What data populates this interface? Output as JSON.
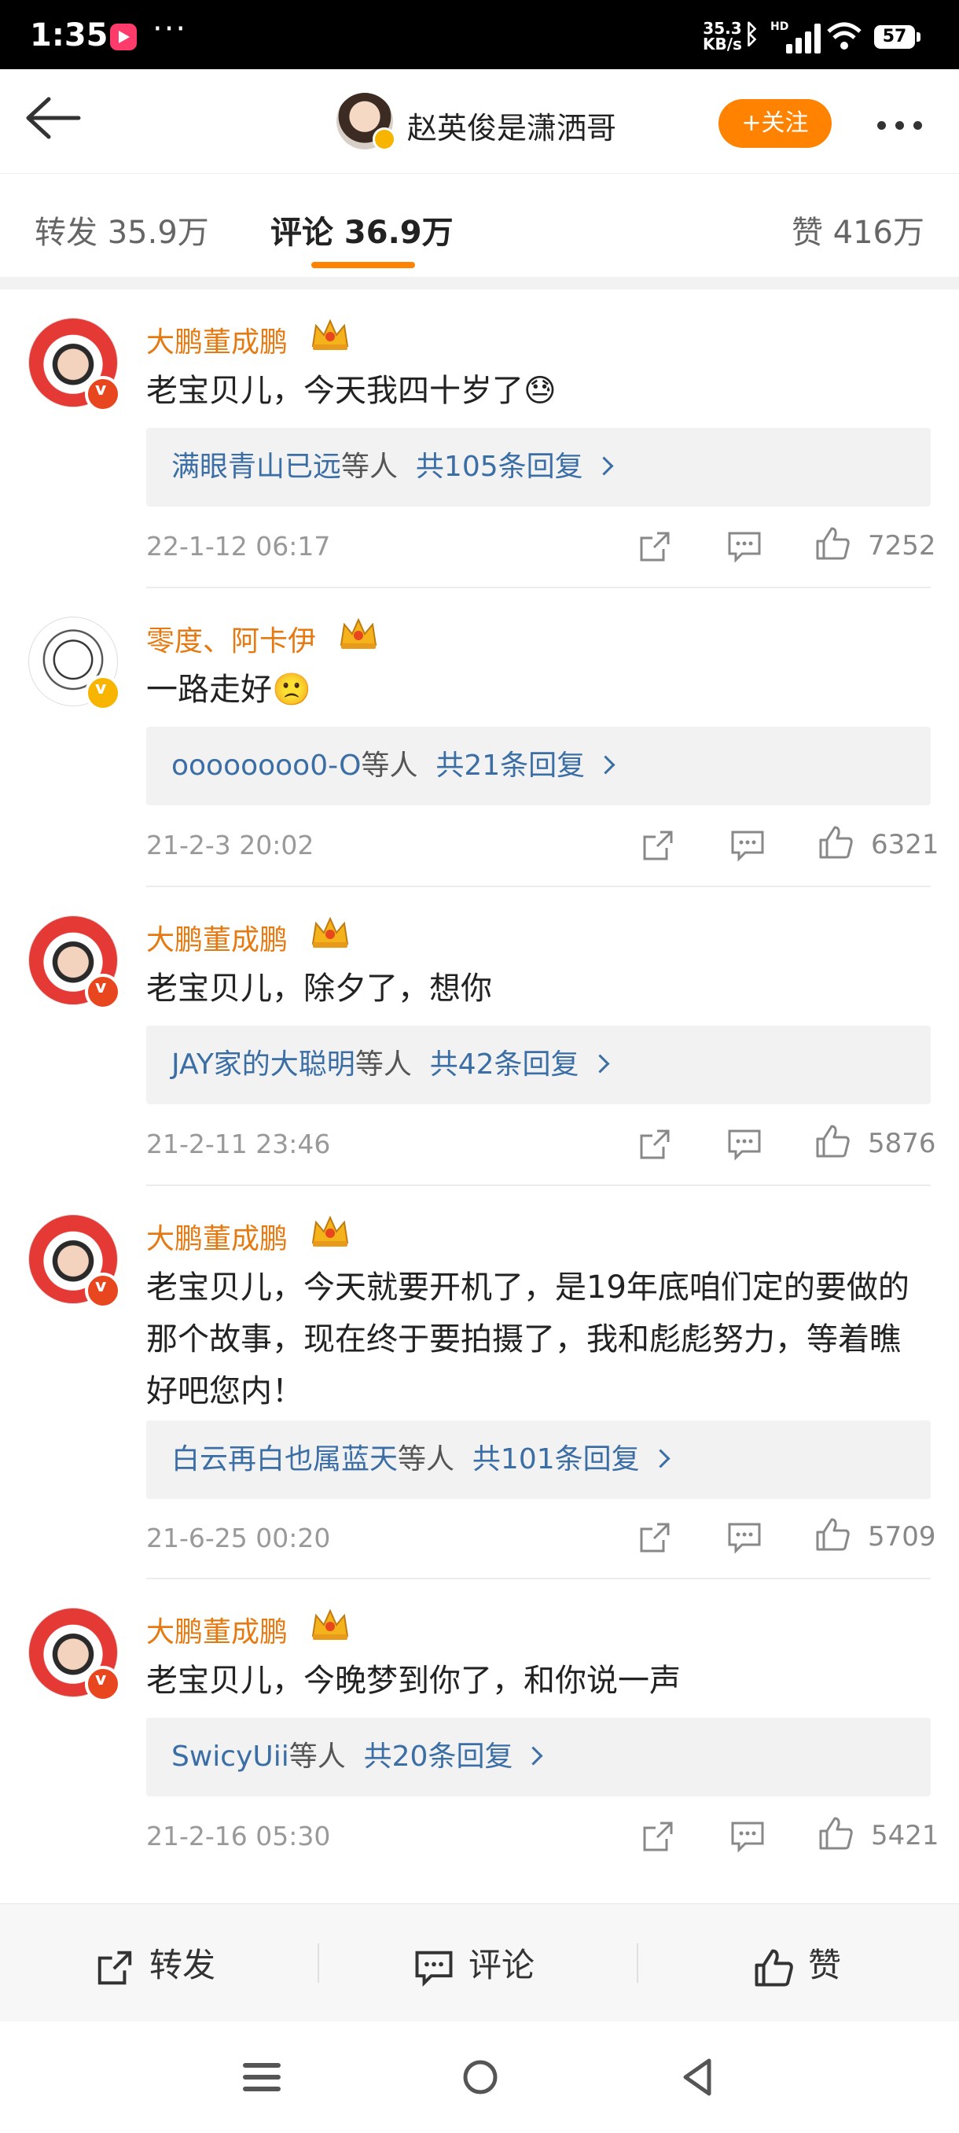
{
  "status_bar": {
    "time": "1:35",
    "speed_value": "35.3",
    "speed_unit": "KB/s",
    "hd": "HD",
    "battery": "57"
  },
  "header": {
    "title": "赵英俊是潇洒哥",
    "follow_label": "+关注"
  },
  "tabs": {
    "repost": "转发 35.9万",
    "comment": "评论 36.9万",
    "like": "赞 416万"
  },
  "comments": [
    {
      "name": "大鹏董成鹏",
      "text": "老宝贝儿，今天我四十岁了😓",
      "reply_users": "满眼青山已远",
      "reply_suffix": "等人",
      "reply_count": "共105条回复",
      "time": "22-1-12 06:17",
      "likes": "7252"
    },
    {
      "name": "零度、阿卡伊",
      "text": "一路走好🙁",
      "reply_users": "oooooooo0-O",
      "reply_suffix": "等人",
      "reply_count": "共21条回复",
      "time": "21-2-3 20:02",
      "likes": "6321"
    },
    {
      "name": "大鹏董成鹏",
      "text": "老宝贝儿，除夕了，想你",
      "reply_users": "JAY家的大聪明",
      "reply_suffix": "等人",
      "reply_count": "共42条回复",
      "time": "21-2-11 23:46",
      "likes": "5876"
    },
    {
      "name": "大鹏董成鹏",
      "text": "老宝贝儿，今天就要开机了，是19年底咱们定的要做的那个故事，现在终于要拍摄了，我和彪彪努力，等着瞧好吧您内！",
      "reply_users": "白云再白也属蓝天",
      "reply_suffix": "等人",
      "reply_count": "共101条回复",
      "time": "21-6-25 00:20",
      "likes": "5709"
    },
    {
      "name": "大鹏董成鹏",
      "text": "老宝贝儿，今晚梦到你了，和你说一声",
      "reply_users": "SwicyUii",
      "reply_suffix": "等人",
      "reply_count": "共20条回复",
      "time": "21-2-16 05:30",
      "likes": "5421"
    }
  ],
  "bottom_bar": {
    "repost": "转发",
    "comment": "评论",
    "like": "赞"
  },
  "colors": {
    "accent": "#ff8200",
    "username": "#e57a12",
    "link": "#3a6ea5"
  }
}
